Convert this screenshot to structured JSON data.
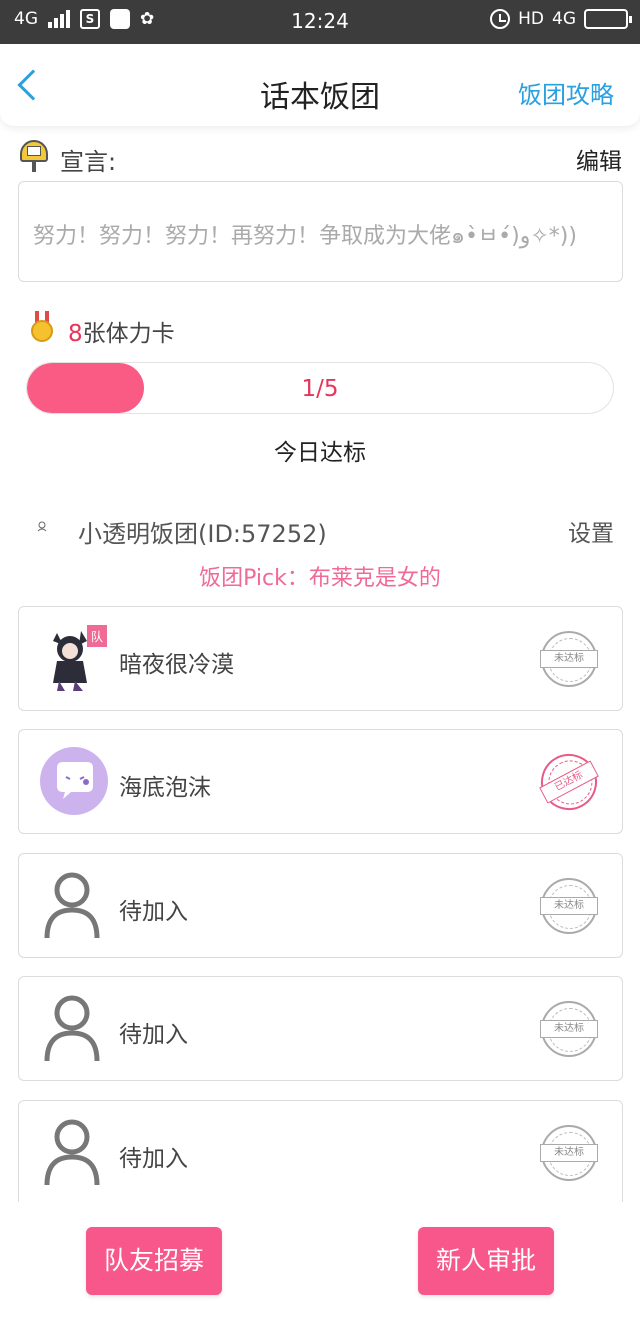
{
  "status_bar": {
    "network_left": "4G",
    "time": "12:24",
    "hd": "HD",
    "network_right": "4G",
    "sim_badge": "S"
  },
  "header": {
    "title": "话本饭团",
    "guide_link": "饭团攻略"
  },
  "declaration": {
    "label": "宣言:",
    "edit": "编辑",
    "text": "努力！努力！努力！再努力！争取成为大佬๑•̀ㅂ•́)و✧*))"
  },
  "stamina": {
    "count": "8",
    "label": "张体力卡",
    "progress_text": "1/5",
    "progress_fraction": 0.2,
    "today_status": "今日达标"
  },
  "group": {
    "name": "小透明饭团(ID:57252)",
    "settings": "设置",
    "pick": "饭团Pick：布莱克是女的"
  },
  "members": [
    {
      "name": "暗夜很冷漠",
      "badge": "队",
      "stamp": "未达标",
      "avatar_icon": "anime-character-avatar"
    },
    {
      "name": "海底泡沫",
      "stamp": "已达标",
      "avatar_icon": "chat-bubble-avatar"
    },
    {
      "name": "待加入",
      "stamp": "未达标",
      "avatar_icon": "person-placeholder-icon"
    },
    {
      "name": "待加入",
      "stamp": "未达标",
      "avatar_icon": "person-placeholder-icon"
    },
    {
      "name": "待加入",
      "stamp": "未达标",
      "avatar_icon": "person-placeholder-icon"
    }
  ],
  "buttons": {
    "recruit": "队友招募",
    "approve": "新人审批"
  },
  "colors": {
    "accent_blue": "#29a0e0",
    "accent_pink": "#f7578a",
    "progress_pink": "#f95b85"
  }
}
